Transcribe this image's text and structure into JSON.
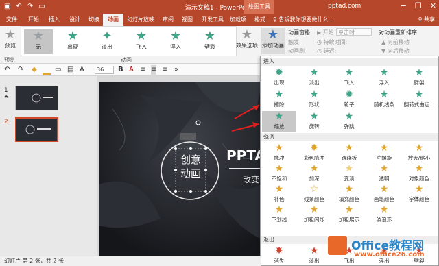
{
  "window": {
    "title": "演示文稿1 - PowerPoint",
    "context_tab": "绘图工具",
    "account": "pptad.com",
    "minimize": "−",
    "restore": "❐",
    "close": "✕"
  },
  "tabs": [
    "文件",
    "开始",
    "插入",
    "设计",
    "切换",
    "动画",
    "幻灯片放映",
    "审阅",
    "视图",
    "开发工具",
    "加载项",
    "格式"
  ],
  "active_tab": "动画",
  "tell_me": "♀ 告诉我你想要做什么...",
  "share": "♀ 共享",
  "ribbon": {
    "preview_label": "预览",
    "preview_group": "预览",
    "animation_group": "动画",
    "gallery": [
      "无",
      "出现",
      "淡出",
      "飞入",
      "浮入",
      "劈裂"
    ],
    "effect_options": "效果选项",
    "add_animation": "添加动画",
    "animation_pane": "动画窗格",
    "trigger": "触发",
    "painter": "动画刷",
    "start_label": "▶ 开始:",
    "start_value": "单击时",
    "duration_label": "◷ 持续时间:",
    "delay_label": "◷ 延迟:",
    "reorder_title": "对动画重新排序",
    "move_earlier": "▲ 向前移动",
    "move_later": "▼ 向后移动"
  },
  "toolbar": {
    "undo": "↶",
    "redo": "↷",
    "font_size": "36",
    "bold": "B",
    "font_color": "A"
  },
  "thumbnails": [
    {
      "number": "1",
      "marker": "★"
    },
    {
      "number": "2"
    }
  ],
  "slide": {
    "circle_text_line1": "创意",
    "circle_text_line2": "动画",
    "title_text": "PPTA",
    "subtitle_text": "改变"
  },
  "dropdown": {
    "section_entrance": "进入",
    "entrance": [
      "出现",
      "淡出",
      "飞入",
      "浮入",
      "劈裂",
      "擦除",
      "形状",
      "轮子",
      "随机线条",
      "翻转式由远...",
      "缩放",
      "旋转",
      "弹跳"
    ],
    "section_emphasis": "强调",
    "emphasis": [
      "脉冲",
      "彩色脉冲",
      "跷跷板",
      "陀螺旋",
      "放大/缩小",
      "不饱和",
      "加深",
      "变淡",
      "透明",
      "对象颜色",
      "补色",
      "线条颜色",
      "填充颜色",
      "画笔颜色",
      "字体颜色",
      "下划线",
      "加粗闪烁",
      "加粗展示",
      "波浪形"
    ],
    "section_exit": "退出",
    "exit": [
      "消失",
      "淡出",
      "飞出",
      "浮出",
      "劈裂"
    ]
  },
  "status": "幻灯片 第 2 张，共 2 张",
  "watermark": {
    "brand": "Office教程网",
    "url": "www.office26.com"
  },
  "colors": {
    "accent": "#b7472a",
    "entrance_star": "#3ea487",
    "emphasis_star": "#e0a531",
    "exit_star": "#d0432f",
    "arrow": "#e02020"
  }
}
